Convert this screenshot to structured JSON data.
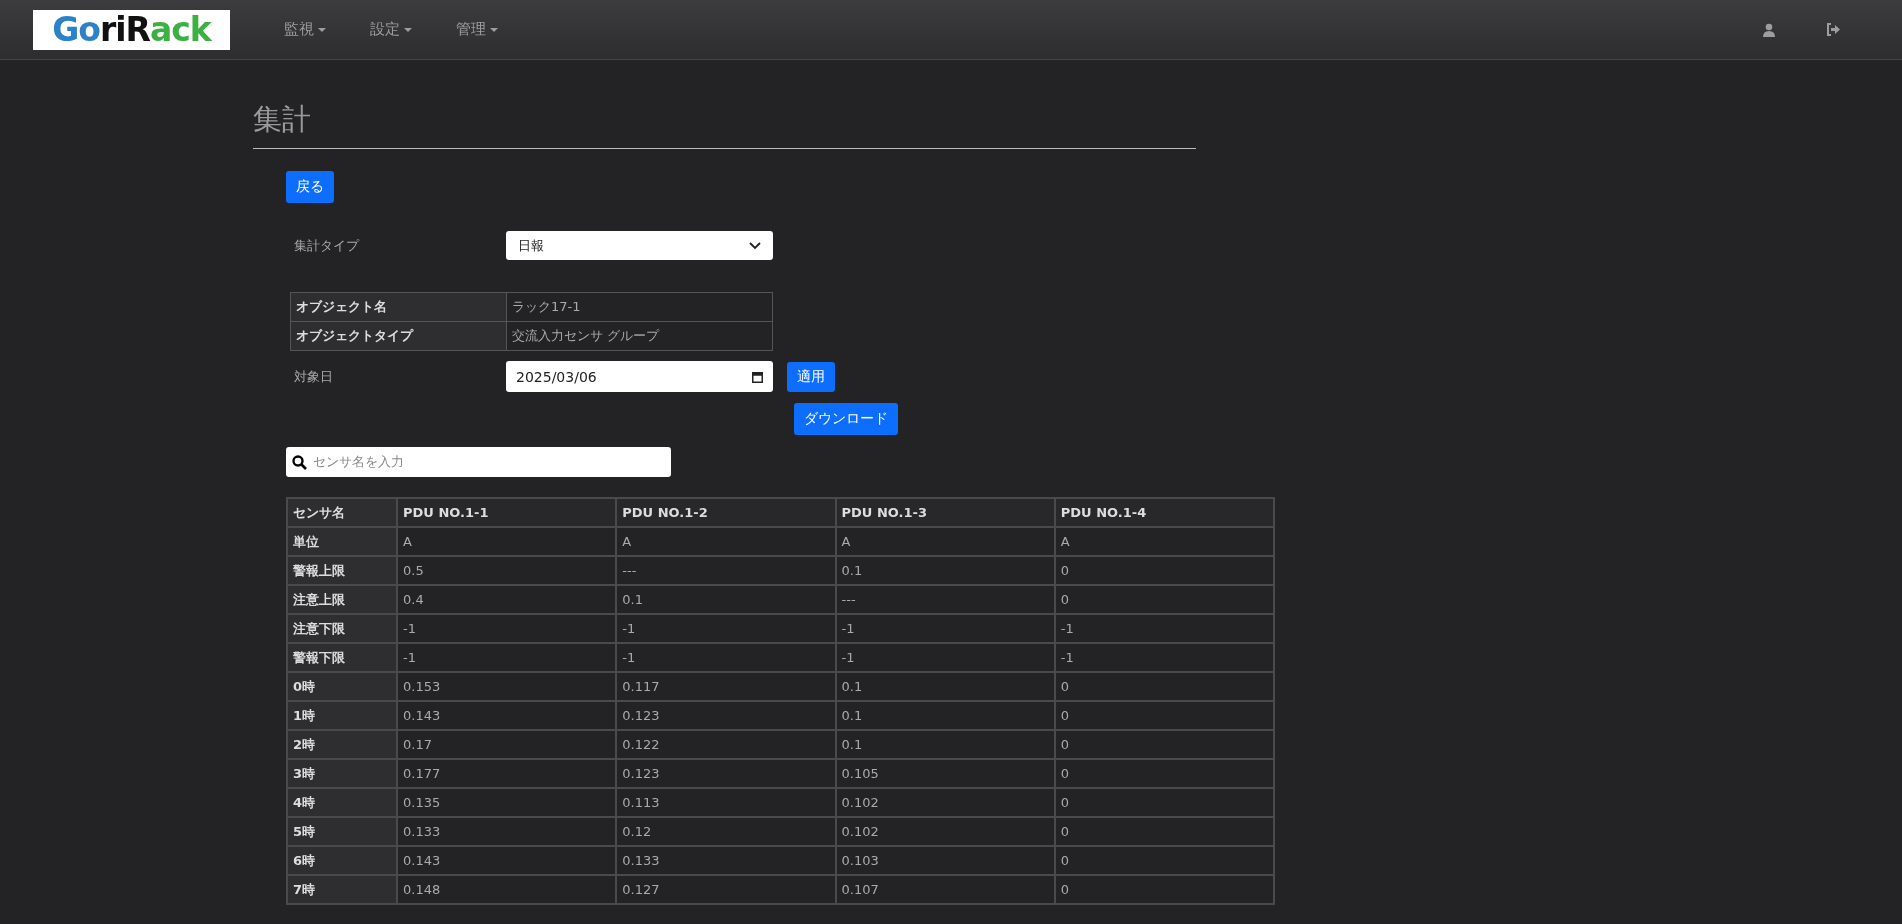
{
  "header": {
    "logo": {
      "parts": [
        {
          "text": "Go",
          "color": "#2b82c9"
        },
        {
          "text": "r",
          "color": "#111111"
        },
        {
          "text": "i",
          "color": "#111111"
        },
        {
          "text": "R",
          "color": "#111111"
        },
        {
          "text": "ack",
          "color": "#3cb043"
        }
      ]
    },
    "nav": [
      {
        "label": "監視"
      },
      {
        "label": "設定"
      },
      {
        "label": "管理"
      }
    ]
  },
  "page": {
    "title": "集計",
    "back_button": "戻る",
    "type_label": "集計タイプ",
    "type_value": "日報",
    "info": [
      {
        "label": "オブジェクト名",
        "value": "ラック17-1"
      },
      {
        "label": "オブジェクトタイプ",
        "value": "交流入力センサ グループ"
      }
    ],
    "date_label": "対象日",
    "date_value": "2025/03/06",
    "apply_button": "適用",
    "download_button": "ダウンロード",
    "search": {
      "placeholder": "センサ名を入力"
    },
    "table": {
      "columns": [
        "センサ名",
        "PDU NO.1-1",
        "PDU NO.1-2",
        "PDU NO.1-3",
        "PDU NO.1-4"
      ],
      "rows": [
        [
          "単位",
          "A",
          "A",
          "A",
          "A"
        ],
        [
          "警報上限",
          "0.5",
          "---",
          "0.1",
          "0"
        ],
        [
          "注意上限",
          "0.4",
          "0.1",
          "---",
          "0"
        ],
        [
          "注意下限",
          "-1",
          "-1",
          "-1",
          "-1"
        ],
        [
          "警報下限",
          "-1",
          "-1",
          "-1",
          "-1"
        ],
        [
          "0時",
          "0.153",
          "0.117",
          "0.1",
          "0"
        ],
        [
          "1時",
          "0.143",
          "0.123",
          "0.1",
          "0"
        ],
        [
          "2時",
          "0.17",
          "0.122",
          "0.1",
          "0"
        ],
        [
          "3時",
          "0.177",
          "0.123",
          "0.105",
          "0"
        ],
        [
          "4時",
          "0.135",
          "0.113",
          "0.102",
          "0"
        ],
        [
          "5時",
          "0.133",
          "0.12",
          "0.102",
          "0"
        ],
        [
          "6時",
          "0.143",
          "0.133",
          "0.103",
          "0"
        ],
        [
          "7時",
          "0.148",
          "0.127",
          "0.107",
          "0"
        ]
      ]
    }
  }
}
